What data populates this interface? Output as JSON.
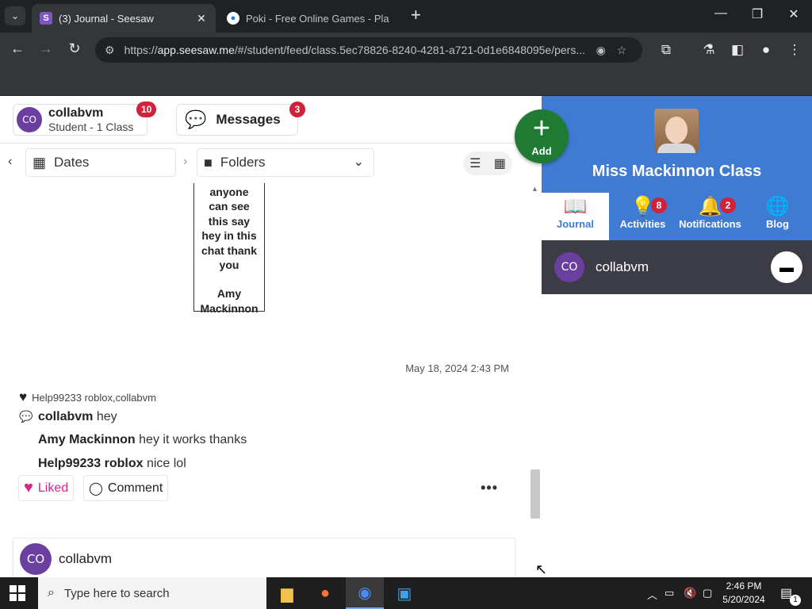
{
  "browser": {
    "tabs": [
      {
        "title": "(3) Journal - Seesaw",
        "active": true
      },
      {
        "title": "Poki - Free Online Games - Pla",
        "active": false
      }
    ],
    "url_prefix": "https://",
    "url_host": "app.seesaw.me",
    "url_path": "/#/student/feed/class.5ec78826-8240-4281-a721-0d1e6848095e/pers..."
  },
  "header": {
    "user_name": "collabvm",
    "user_sub": "Student - 1 Class",
    "user_initials": "CO",
    "user_badge": "10",
    "messages_label": "Messages",
    "messages_badge": "3"
  },
  "filters": {
    "dates_label": "Dates",
    "folders_label": "Folders"
  },
  "post": {
    "note_lines": [
      "anyone",
      "can see",
      "this say",
      "hey in this",
      "chat thank",
      "you",
      "",
      "Amy",
      "Mackinnon"
    ],
    "timestamp": "May 18, 2024 2:43 PM",
    "liked_by": "Help99233 roblox,collabvm",
    "comments": [
      {
        "author": "collabvm",
        "text": "hey"
      },
      {
        "author": "Amy Mackinnon",
        "text": "hey it works thanks"
      },
      {
        "author": "Help99233 roblox",
        "text": "nice lol"
      }
    ],
    "liked_label": "Liked",
    "comment_label": "Comment"
  },
  "next_post": {
    "initials": "CO",
    "name": "collabvm"
  },
  "add_button": {
    "label": "Add"
  },
  "class_panel": {
    "class_name": "Miss Mackinnon Class",
    "tabs": [
      {
        "label": "Journal",
        "icon": "book-icon",
        "badge": ""
      },
      {
        "label": "Activities",
        "icon": "lightbulb-icon",
        "badge": "8"
      },
      {
        "label": "Notifications",
        "icon": "bell-icon",
        "badge": "2"
      },
      {
        "label": "Blog",
        "icon": "globe-icon",
        "badge": ""
      }
    ],
    "student": {
      "initials": "CO",
      "name": "collabvm"
    }
  },
  "taskbar": {
    "search_placeholder": "Type here to search",
    "time": "2:46 PM",
    "date": "5/20/2024",
    "notification_count": "1"
  },
  "colors": {
    "seesaw_blue": "#3f7bd3",
    "add_green": "#1f7a34",
    "badge_red": "#d0223b",
    "avatar_purple": "#6b3fa0",
    "liked_pink": "#d6288a"
  }
}
